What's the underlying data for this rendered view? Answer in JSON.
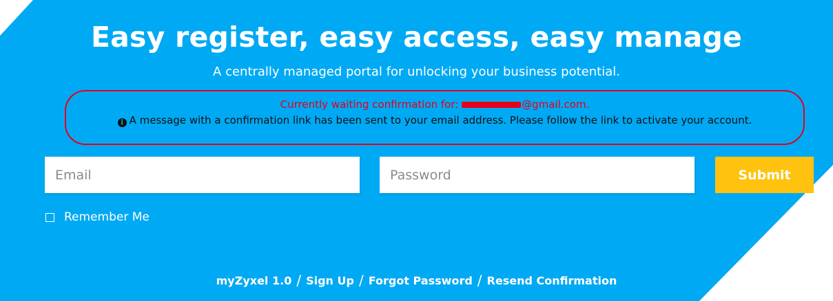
{
  "header": {
    "title": "Easy register, easy access, easy manage",
    "subtitle": "A centrally managed portal for unlocking your business potential."
  },
  "notice": {
    "waiting_prefix": "Currently waiting confirmation for:",
    "email_domain": "@gmail.com.",
    "icon": "info-circle-icon",
    "message": "A message with a confirmation link has been sent to your email address. Please follow the link to activate your account."
  },
  "form": {
    "email_placeholder": "Email",
    "password_placeholder": "Password",
    "submit_label": "Submit",
    "remember_label": "Remember Me",
    "remember_checked": false
  },
  "footer": {
    "links": [
      "myZyxel 1.0",
      "Sign Up",
      "Forgot Password",
      "Resend Confirmation"
    ],
    "separator": "/"
  },
  "colors": {
    "background": "#00a9f4",
    "accent": "#ffc20e",
    "notice": "#e3001b"
  }
}
